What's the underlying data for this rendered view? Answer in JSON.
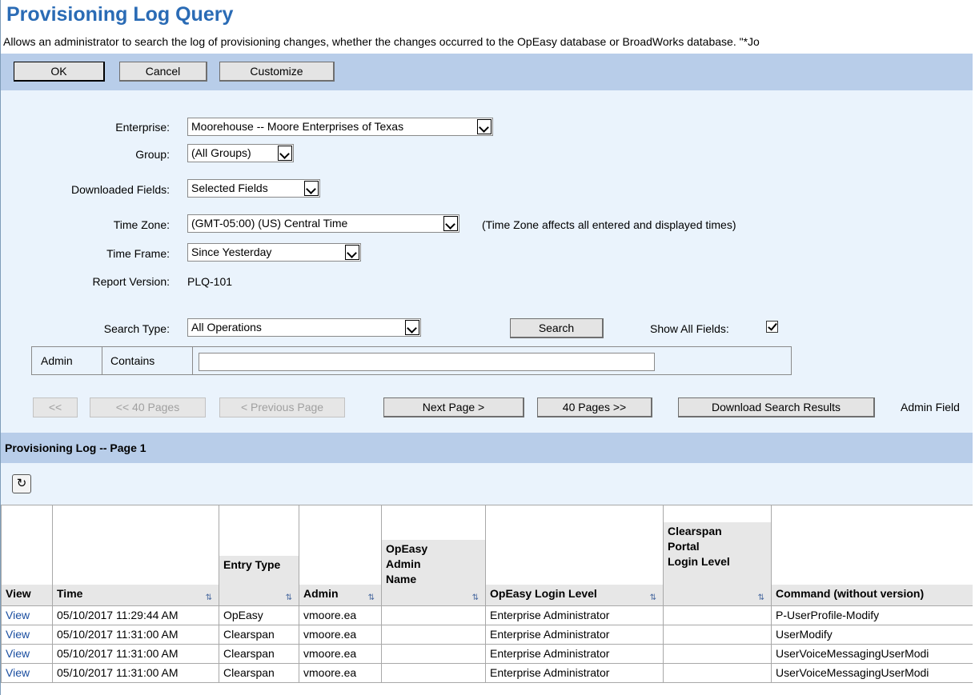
{
  "page": {
    "title": "Provisioning Log Query",
    "description": "Allows an administrator to search the log of provisioning changes, whether the changes occurred to the OpEasy database or BroadWorks database. \"*Jo"
  },
  "toolbar": {
    "ok_label": "OK",
    "cancel_label": "Cancel",
    "customize_label": "Customize"
  },
  "form": {
    "enterprise_label": "Enterprise:",
    "enterprise_value": "Moorehouse -- Moore Enterprises of Texas",
    "group_label": "Group:",
    "group_value": "(All Groups)",
    "downloaded_label": "Downloaded Fields:",
    "downloaded_value": "Selected Fields",
    "timezone_label": "Time Zone:",
    "timezone_value": "(GMT-05:00) (US) Central Time",
    "timezone_note": "(Time Zone affects all entered and displayed times)",
    "timeframe_label": "Time Frame:",
    "timeframe_value": "Since Yesterday",
    "report_label": "Report Version:",
    "report_value": "PLQ-101",
    "searchtype_label": "Search Type:",
    "searchtype_value": "All Operations",
    "search_button": "Search",
    "showall_label": "Show All Fields:",
    "showall_checked": true
  },
  "filter": {
    "field": "Admin",
    "operator": "Contains",
    "value": ""
  },
  "paging": {
    "first": "<<",
    "back40": "<< 40 Pages",
    "prev": "< Previous Page",
    "next": "Next Page  >",
    "fwd40": "40 Pages >>",
    "download": "Download Search Results",
    "admin_fields": "Admin Field"
  },
  "log": {
    "title": "Provisioning Log -- Page 1",
    "columns": [
      "View",
      "Time",
      "Entry Type",
      "Admin",
      "OpEasy Admin Name",
      "OpEasy Login Level",
      "Clearspan Portal Login Level",
      "Command (without version)"
    ],
    "rows": [
      [
        "View",
        "05/10/2017 11:29:44 AM",
        "OpEasy",
        "vmoore.ea",
        "",
        "Enterprise Administrator",
        "",
        "P-UserProfile-Modify"
      ],
      [
        "View",
        "05/10/2017 11:31:00 AM",
        "Clearspan",
        "vmoore.ea",
        "",
        "Enterprise Administrator",
        "",
        "UserModify"
      ],
      [
        "View",
        "05/10/2017 11:31:00 AM",
        "Clearspan",
        "vmoore.ea",
        "",
        "Enterprise Administrator",
        "",
        "UserVoiceMessagingUserModi"
      ],
      [
        "View",
        "05/10/2017 11:31:00 AM",
        "Clearspan",
        "vmoore.ea",
        "",
        "Enterprise Administrator",
        "",
        "UserVoiceMessagingUserModi"
      ]
    ]
  },
  "colors": {
    "title": "#2a6bb5",
    "toolbar_bg": "#b8cde9",
    "form_bg": "#eaf3fc",
    "link": "#1a4ea0"
  }
}
